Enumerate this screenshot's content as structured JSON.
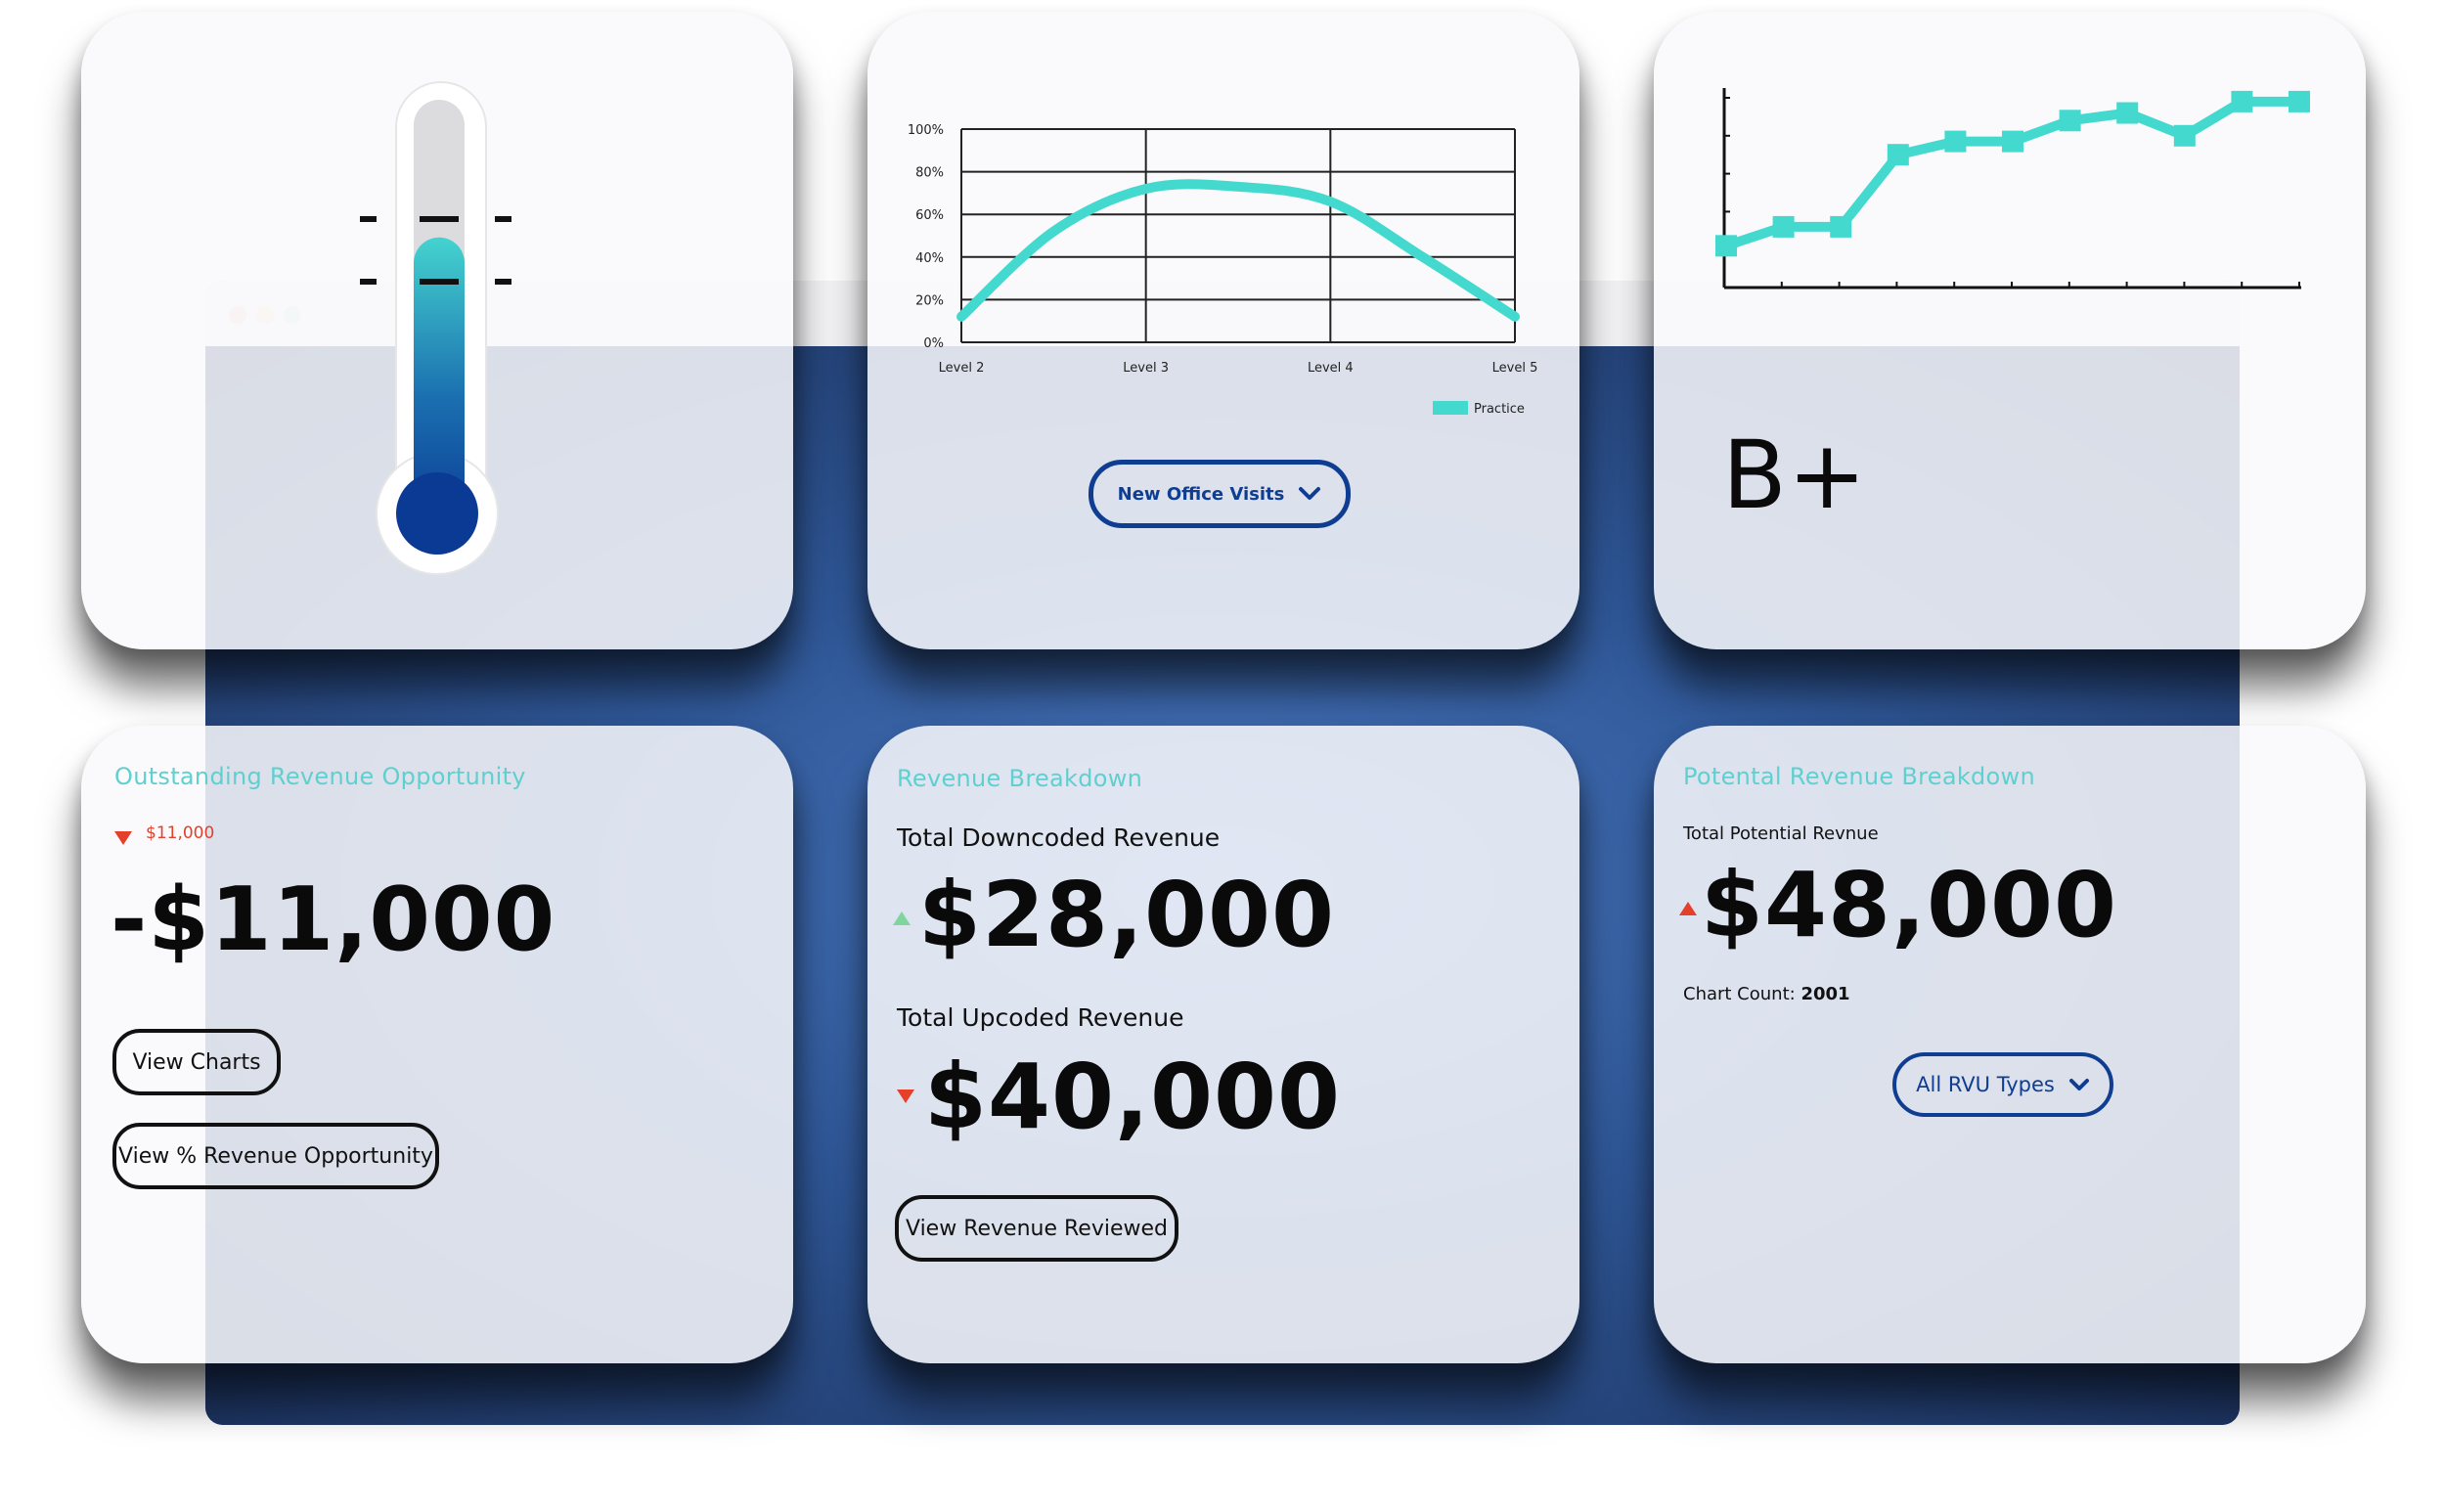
{
  "colors": {
    "teal": "#44d9cf",
    "navy": "#0f3d91",
    "red": "#e5402a",
    "green": "#7fd59e",
    "card_title": "#5fd0cf"
  },
  "thermometer": {
    "level_fraction": 0.68
  },
  "level_chart": {
    "chart_data": {
      "type": "line",
      "categories": [
        "Level 2",
        "Level 3",
        "Level 4",
        "Level 5"
      ],
      "series": [
        {
          "name": "Practice",
          "x": [
            0,
            0.5,
            1,
            1.5,
            2,
            2.5,
            3
          ],
          "values": [
            12,
            52,
            72,
            73,
            66,
            40,
            12
          ]
        }
      ],
      "y_ticks": [
        "0%",
        "20%",
        "40%",
        "60%",
        "80%",
        "100%"
      ],
      "ylim": [
        0,
        100
      ],
      "grid": true,
      "legend": "bottom-right"
    },
    "dropdown_label": "New Office Visits"
  },
  "trend_chart": {
    "chart_data": {
      "type": "line",
      "x": [
        1,
        2,
        3,
        4,
        5,
        6,
        7,
        8,
        9,
        10,
        11
      ],
      "values": [
        22,
        32,
        32,
        70,
        77,
        77,
        88,
        92,
        80,
        98,
        98
      ],
      "ylim": [
        0,
        100
      ],
      "grid": false
    },
    "grade": "B+"
  },
  "outstanding": {
    "title": "Outstanding Revenue Opportunity",
    "change": "$11,000",
    "amount": "-$11,000",
    "view_charts": "View Charts",
    "view_pct": "View % Revenue Opportunity"
  },
  "breakdown": {
    "title": "Revenue Breakdown",
    "downcoded_label": "Total Downcoded Revenue",
    "downcoded_amount": "$28,000",
    "upcoded_label": "Total Upcoded Revenue",
    "upcoded_amount": "$40,000",
    "view_reviewed": "View Revenue Reviewed"
  },
  "potential": {
    "title": "Potental Revenue Breakdown",
    "total_label": "Total Potential Revnue",
    "total_amount": "$48,000",
    "chart_count_label": "Chart Count:",
    "chart_count_value": "2001",
    "rvu_dropdown": "All RVU Types"
  }
}
